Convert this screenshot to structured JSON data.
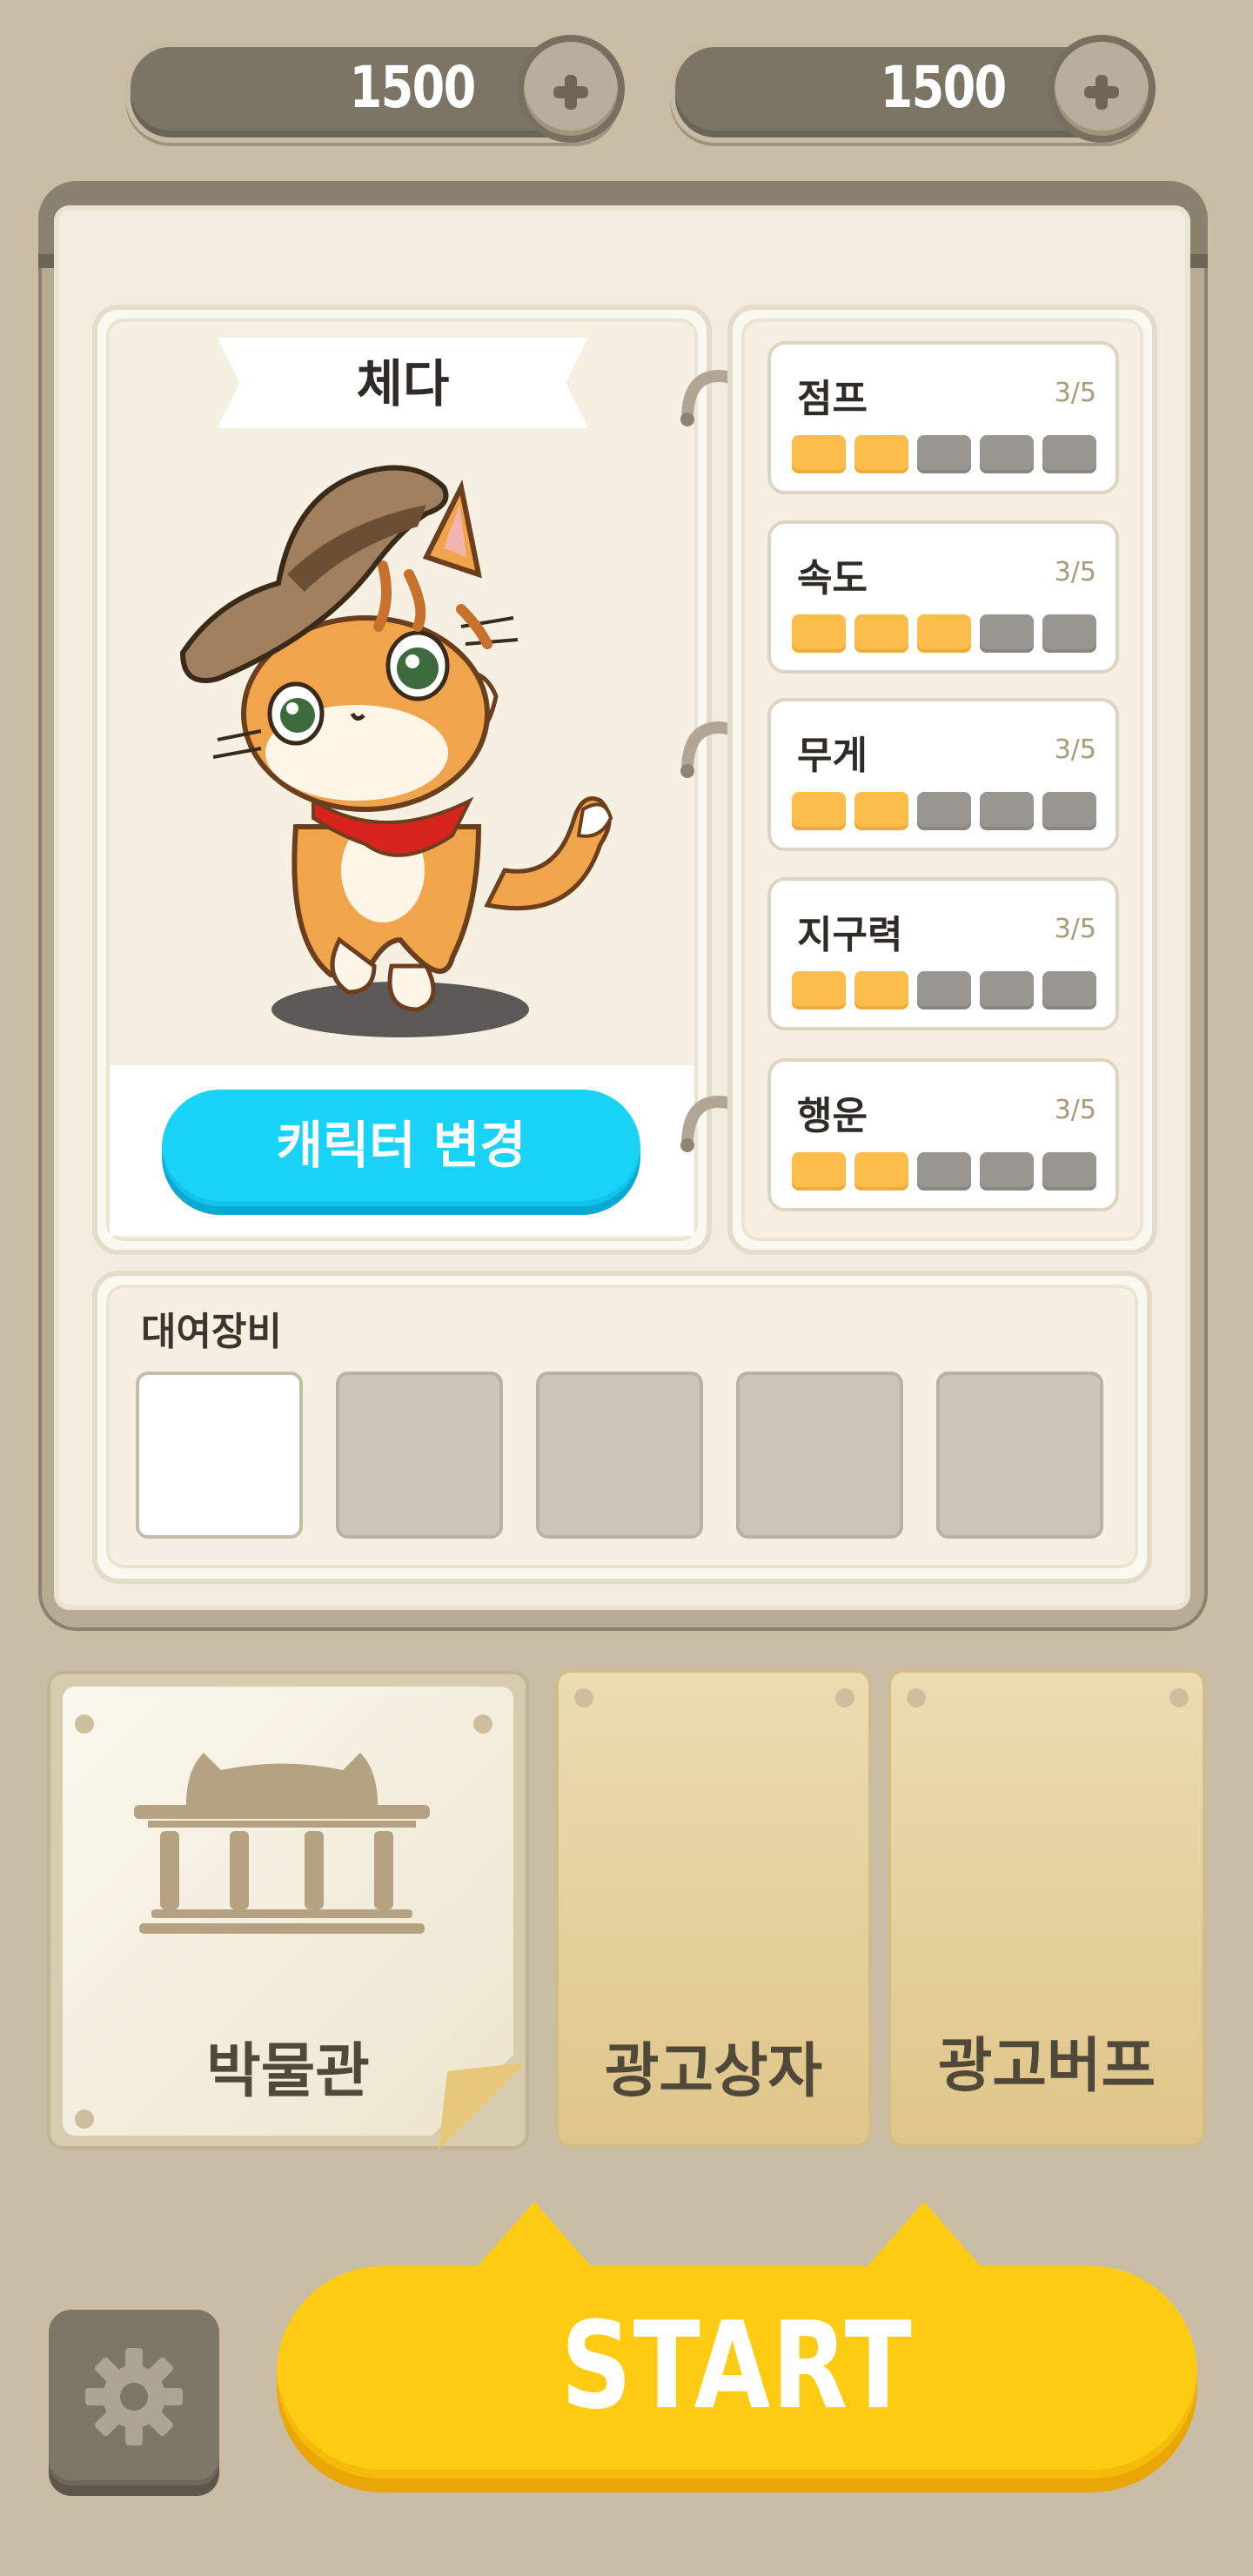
{
  "currency": [
    {
      "value": "1500",
      "icon": "plus-icon"
    },
    {
      "value": "1500",
      "icon": "plus-icon"
    }
  ],
  "character": {
    "name": "체다",
    "change_button": "캐릭터 변경"
  },
  "stats": [
    {
      "label": "점프",
      "value": "3/5",
      "filled": 2,
      "total": 5
    },
    {
      "label": "속도",
      "value": "3/5",
      "filled": 3,
      "total": 5
    },
    {
      "label": "무게",
      "value": "3/5",
      "filled": 2,
      "total": 5
    },
    {
      "label": "지구력",
      "value": "3/5",
      "filled": 2,
      "total": 5
    },
    {
      "label": "행운",
      "value": "3/5",
      "filled": 2,
      "total": 5
    }
  ],
  "equipment": {
    "title": "대여장비",
    "slots": 5
  },
  "menu": {
    "museum": "박물관",
    "ad_box": "광고상자",
    "ad_buff": "광고버프"
  },
  "start_label": "START",
  "colors": {
    "background": "#cabda6",
    "accent_blue": "#18d3f6",
    "start_yellow": "#fdcc12",
    "bar_on": "#fcbd4d",
    "bar_off": "#999591"
  }
}
